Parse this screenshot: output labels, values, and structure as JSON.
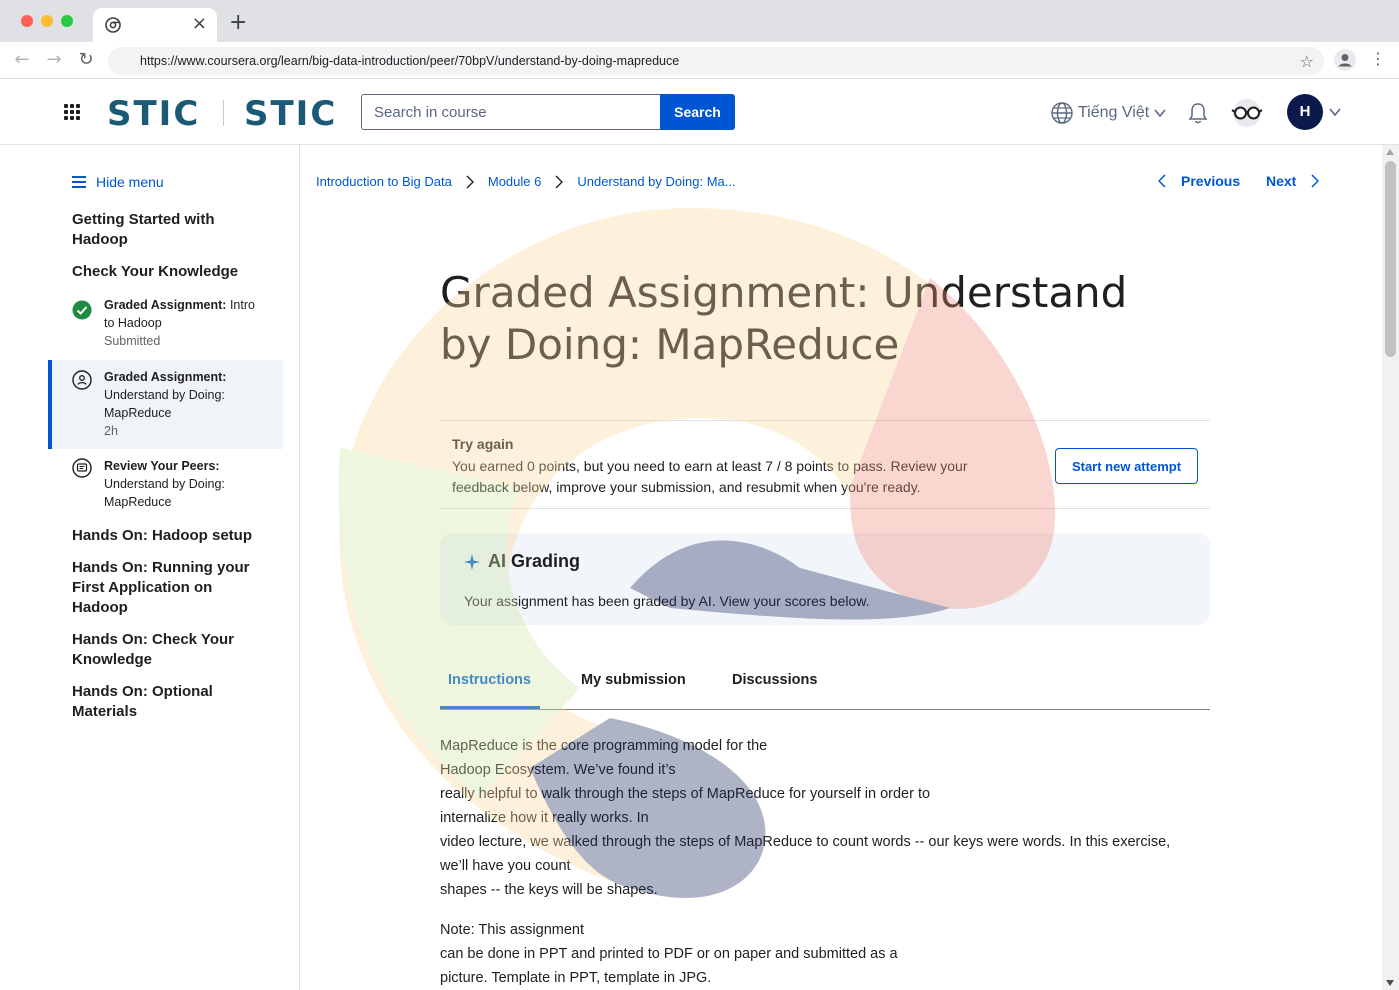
{
  "browser": {
    "url": "https://www.coursera.org/learn/big-data-introduction/peer/70bpV/understand-by-doing-mapreduce",
    "tab_close": "×",
    "new_tab": "+"
  },
  "header": {
    "logo_left": "STIC",
    "logo_right": "STIC",
    "search_placeholder": "Search in course",
    "search_button": "Search",
    "language": "Tiếng Việt",
    "avatar_initial": "H"
  },
  "sidebar": {
    "hide_menu": "Hide menu",
    "sections": [
      {
        "title": "Getting Started with Hadoop"
      },
      {
        "title": "Check Your Knowledge"
      }
    ],
    "items": [
      {
        "title": "Graded Assignment:",
        "subtitle": " Intro to Hadoop",
        "meta": "Submitted"
      },
      {
        "title": "Graded Assignment:",
        "subtitle": "Understand by Doing: MapReduce",
        "meta": "2h"
      },
      {
        "title": "Review Your Peers:",
        "subtitle": "Understand by Doing: MapReduce",
        "meta": ""
      }
    ],
    "more_sections": [
      {
        "title": "Hands On: Hadoop setup"
      },
      {
        "title": "Hands On: Running your First Application on Hadoop"
      },
      {
        "title": "Hands On: Check Your Knowledge"
      },
      {
        "title": "Hands On: Optional Materials"
      }
    ]
  },
  "breadcrumb": {
    "items": [
      "Introduction to Big Data",
      "Module 6",
      "Understand by Doing: Ma..."
    ]
  },
  "nav": {
    "previous": "Previous",
    "next": "Next"
  },
  "main": {
    "title": "Graded Assignment: Understand by Doing: MapReduce",
    "try_again": {
      "title": "Try again",
      "message": "You earned 0 points, but you need to earn at least 7 / 8 points to pass. Review your feedback below, improve your submission, and resubmit when you're ready.",
      "button": "Start new attempt"
    },
    "ai_grading": {
      "title": "AI Grading",
      "message": "Your assignment has been graded by AI. View your scores below."
    },
    "tabs": [
      "Instructions",
      "My submission",
      "Discussions"
    ],
    "instructions": {
      "paragraph1_lines": [
        "MapReduce is the core programming model for the",
        "Hadoop Ecosystem.  We’ve found it’s",
        "really helpful to walk through the steps of MapReduce for yourself in order to",
        "internalize how it really works.  In",
        "video lecture, we walked through the steps of MapReduce to count words -- our keys were words.  In this exercise,",
        "we’ll have you count",
        "shapes -- the keys will be shapes."
      ],
      "paragraph2_lines": [
        "Note:  This assignment",
        "can be done in PPT and printed to PDF or on paper and submitted as a",
        "picture.  Template in PPT, template in JPG."
      ]
    }
  },
  "colors": {
    "accent": "#0056d2",
    "logo": "#1a5a74",
    "avatar_bg": "#0b1a4b",
    "success": "#1e8c45"
  },
  "icons": [
    "grid-icon",
    "globe-icon",
    "bell-icon",
    "glasses-icon",
    "chevron-down-icon",
    "menu-icon",
    "check-circle-icon",
    "assignment-icon",
    "review-icon",
    "chevron-right-icon",
    "chevron-left-icon",
    "sparkle-icon"
  ]
}
